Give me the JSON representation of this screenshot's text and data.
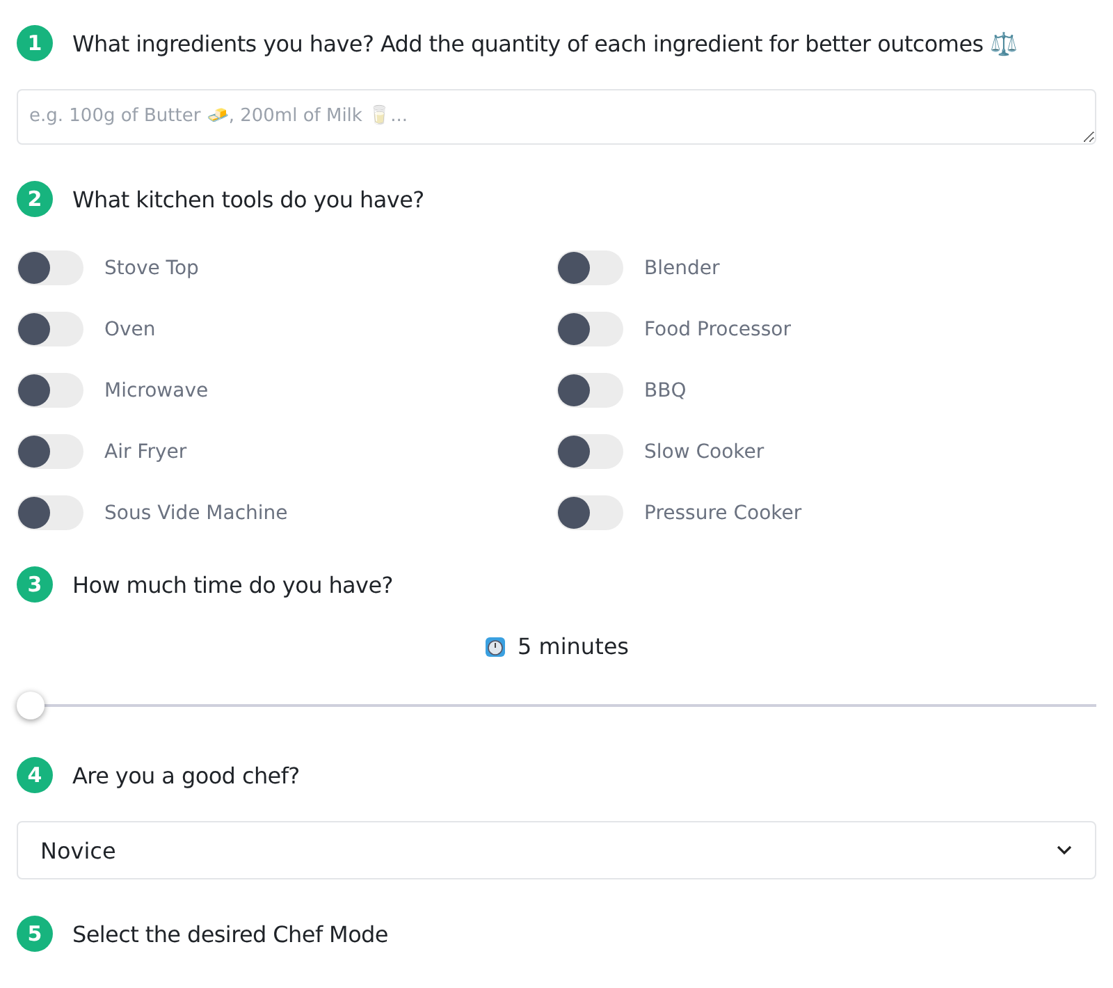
{
  "steps": [
    {
      "number": "1",
      "title": "What ingredients you have? Add the quantity of each ingredient for better outcomes ⚖️",
      "kind": "ingredients",
      "placeholder": "e.g. 100g of Butter 🧈, 200ml of Milk 🥛..."
    },
    {
      "number": "2",
      "title": "What kitchen tools do you have?",
      "kind": "tools",
      "tools": [
        {
          "label": "Stove Top",
          "on": false
        },
        {
          "label": "Blender",
          "on": false
        },
        {
          "label": "Oven",
          "on": false
        },
        {
          "label": "Food Processor",
          "on": false
        },
        {
          "label": "Microwave",
          "on": false
        },
        {
          "label": "BBQ",
          "on": false
        },
        {
          "label": "Air Fryer",
          "on": false
        },
        {
          "label": "Slow Cooker",
          "on": false
        },
        {
          "label": "Sous Vide Machine",
          "on": false
        },
        {
          "label": "Pressure Cooker",
          "on": false
        }
      ]
    },
    {
      "number": "3",
      "title": "How much time do you have?",
      "kind": "time",
      "reading": "5 minutes",
      "level": 0
    },
    {
      "number": "4",
      "title": "Are you a good chef?",
      "kind": "select",
      "value": "Novice"
    },
    {
      "number": "5",
      "title": "Select the desired Chef Mode",
      "kind": "header"
    }
  ]
}
